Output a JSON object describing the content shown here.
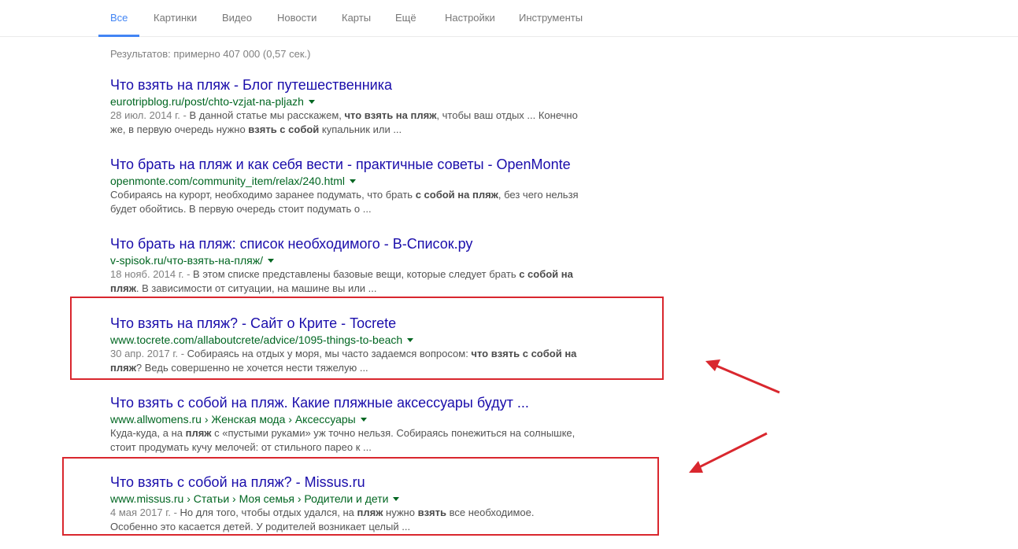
{
  "tabs": [
    {
      "label": "Все",
      "active": true
    },
    {
      "label": "Картинки"
    },
    {
      "label": "Видео"
    },
    {
      "label": "Новости"
    },
    {
      "label": "Карты"
    },
    {
      "label": "Ещё"
    },
    {
      "label": "Настройки"
    },
    {
      "label": "Инструменты"
    }
  ],
  "stats": "Результатов: примерно 407 000 (0,57 сек.)",
  "results": [
    {
      "title": "Что взять на пляж - Блог путешественника",
      "url": "eurotripblog.ru/post/chto-vzjat-na-pljazh",
      "date": "28 июл. 2014 г. - ",
      "snippet_parts": [
        {
          "t": "В данной статье мы расскажем, "
        },
        {
          "t": "что взять на пляж",
          "b": true
        },
        {
          "t": ", чтобы ваш отдых ... Конечно же, в первую очередь нужно "
        },
        {
          "t": "взять с собой",
          "b": true
        },
        {
          "t": " купальник или ..."
        }
      ]
    },
    {
      "title": "Что брать на пляж и как себя вести - практичные советы - OpenMonte",
      "url": "openmonte.com/community_item/relax/240.html",
      "date": "",
      "snippet_parts": [
        {
          "t": "Собираясь на курорт, необходимо заранее подумать, что брать "
        },
        {
          "t": "с собой на пляж",
          "b": true
        },
        {
          "t": ", без чего нельзя будет обойтись. В первую очередь стоит подумать о ..."
        }
      ]
    },
    {
      "title": "Что брать на пляж: список необходимого - В-Список.ру",
      "url": "v-spisok.ru/что-взять-на-пляж/",
      "date": "18 нояб. 2014 г. - ",
      "snippet_parts": [
        {
          "t": "В этом списке представлены базовые вещи, которые следует брать "
        },
        {
          "t": "с собой на пляж",
          "b": true
        },
        {
          "t": ". В зависимости от ситуации, на машине вы или ..."
        }
      ]
    },
    {
      "title": "Что взять на пляж? - Сайт о Крите - Tocrete",
      "url": "www.tocrete.com/allaboutcrete/advice/1095-things-to-beach",
      "date": "30 апр. 2017 г. - ",
      "snippet_parts": [
        {
          "t": "Собираясь на отдых у моря, мы часто задаемся вопросом: "
        },
        {
          "t": "что взять с собой на пляж",
          "b": true
        },
        {
          "t": "? Ведь совершенно не хочется нести тяжелую ..."
        }
      ]
    },
    {
      "title": "Что взять с собой на пляж. Какие пляжные аксессуары будут ...",
      "url": "www.allwomens.ru › Женская мода › Аксессуары",
      "date": "",
      "snippet_parts": [
        {
          "t": "Куда-куда, а на "
        },
        {
          "t": "пляж",
          "b": true
        },
        {
          "t": " с «пустыми руками» уж точно нельзя. Собираясь понежиться на солнышке, стоит продумать кучу мелочей: от стильного парео к ..."
        }
      ]
    },
    {
      "title": "Что взять с собой на пляж? - Missus.ru",
      "url": "www.missus.ru › Статьи › Моя семья › Родители и дети",
      "date": "4 мая 2017 г. - ",
      "snippet_parts": [
        {
          "t": "Но для того, чтобы отдых удался, на "
        },
        {
          "t": "пляж",
          "b": true
        },
        {
          "t": " нужно "
        },
        {
          "t": "взять",
          "b": true
        },
        {
          "t": " все необходимое. Особенно это касается детей. У родителей возникает целый ..."
        }
      ]
    }
  ],
  "colors": {
    "accent": "#4285f4",
    "link": "#1a0dab",
    "url": "#006621",
    "annotation": "#d9272e"
  },
  "icons": [
    "caret-down-icon",
    "arrow-annotation"
  ]
}
